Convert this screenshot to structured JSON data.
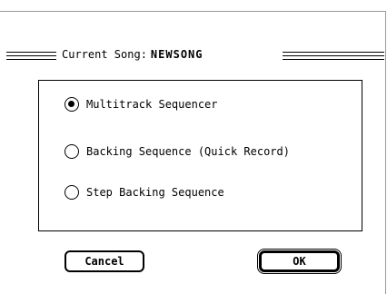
{
  "dialog": {
    "title_prefix": "Current Song:",
    "song_name": "NEWSONG",
    "options": [
      {
        "label": "Multitrack Sequencer",
        "selected": true
      },
      {
        "label": "Backing Sequence (Quick Record)",
        "selected": false
      },
      {
        "label": "Step Backing Sequence",
        "selected": false
      }
    ],
    "cancel_label": "Cancel",
    "ok_label": "OK"
  }
}
